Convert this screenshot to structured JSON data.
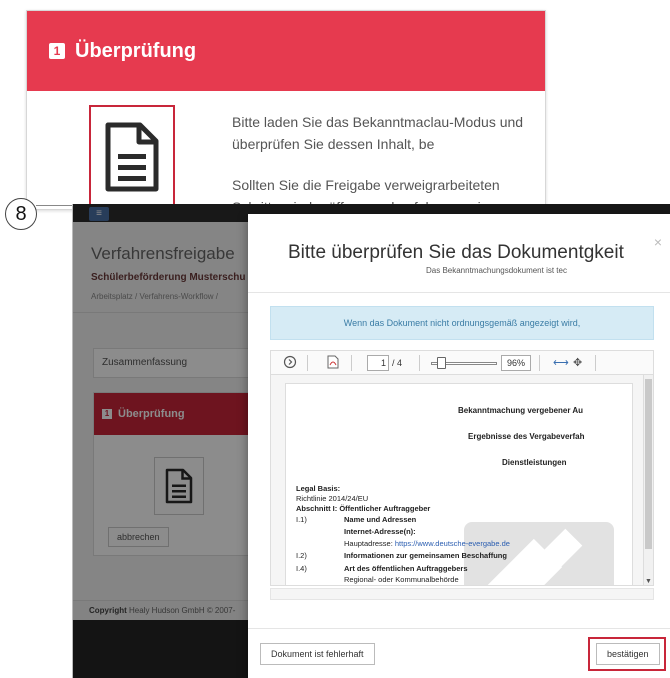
{
  "step": {
    "number": "8"
  },
  "zoom_panel": {
    "badge": "1",
    "title": "Überprüfung",
    "text_line1": "Bitte laden Sie das Bekanntmaclau-Modus und",
    "text_line2": "überprüfen Sie dessen Inhalt, be",
    "text_line3": "Sollten Sie die Freigabe verweigrarbeiteten",
    "text_line4": "Schritte wieder öffnen und ggf. hg zuweisen."
  },
  "background_app": {
    "menu_icon": "menu-icon",
    "title": "Verfahrensfreigabe",
    "subtitle": "Schülerbeförderung Musterschu",
    "breadcrumb": "Arbeitsplatz  /  Verfahrens-Workflow  /",
    "summary_label": "Zusammenfassung",
    "panel_badge": "1",
    "panel_title": "Überprüfung",
    "cancel_label": "abbrechen",
    "footer_bold": "Copyright",
    "footer_text": " Healy Hudson GmbH © 2007-"
  },
  "modal": {
    "title": "Bitte überprüfen Sie das Dokumentgkeit",
    "subtitle": "Das Bekanntmachungsdokument ist tec",
    "close": "×",
    "info": "Wenn das Dokument nicht ordnungsgemäß angezeigt wird,",
    "viewer": {
      "page_current": "1",
      "page_total": "/ 4",
      "zoom": "96%",
      "slider_level": 0.1,
      "icons": [
        "rotate-icon",
        "pdf-icon",
        "fit-width-icon",
        "move-icon"
      ]
    },
    "document": {
      "heading1": "Bekanntmachung vergebener Au",
      "heading2": "Ergebnisse des Vergabeverfah",
      "heading3": "Dienstleistungen",
      "legal_basis_label": "Legal Basis:",
      "legal_basis_value": "Richtlinie 2014/24/EU",
      "section1": "Abschnitt I: Öffentlicher Auftraggeber",
      "i1_num": "I.1)",
      "i1_title": "Name und Adressen",
      "internet_label": "Internet-Adresse(n):",
      "hauptadresse_label": "Hauptadresse: ",
      "hauptadresse_link": "https://www.deutsche-evergabe.de",
      "i2_num": "I.2)",
      "i2_title": "Informationen zur gemeinsamen Beschaffung",
      "i4_num": "I.4)",
      "i4_title": "Art des öffentlichen Auftraggebers",
      "i4_value": "Regional- oder Kommunalbehörde"
    },
    "btn_error": "Dokument ist fehlerhaft",
    "btn_confirm": "bestätigen"
  }
}
